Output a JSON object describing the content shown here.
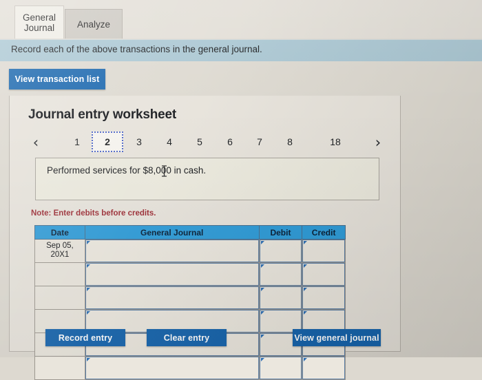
{
  "tabs": [
    {
      "label": "General\nJournal",
      "label_line1": "General",
      "label_line2": "Journal",
      "active": true
    },
    {
      "label": "Analyze",
      "active": false
    }
  ],
  "banner": {
    "text": "Record each of the above transactions in the general journal."
  },
  "buttons": {
    "view_transaction_list": "View transaction list",
    "record_entry": "Record entry",
    "clear_entry": "Clear entry",
    "view_general_journal": "View general journal"
  },
  "worksheet": {
    "title": "Journal entry worksheet",
    "pager": {
      "prev_icon": "chevron-left",
      "prev_glyph": "‹",
      "next_icon": "chevron-right",
      "next_glyph": "›",
      "pages": [
        "1",
        "2",
        "3",
        "4",
        "5",
        "6",
        "7",
        "8",
        "18"
      ],
      "selected": "2"
    },
    "description": "Performed services for $8,000 in cash.",
    "note": "Note: Enter debits before credits."
  },
  "table": {
    "headers": [
      "Date",
      "General Journal",
      "Debit",
      "Credit"
    ],
    "rows": [
      {
        "date_line1": "Sep 05,",
        "date_line2": "20X1",
        "general_journal": "",
        "debit": "",
        "credit": ""
      },
      {
        "date_line1": "",
        "date_line2": "",
        "general_journal": "",
        "debit": "",
        "credit": ""
      },
      {
        "date_line1": "",
        "date_line2": "",
        "general_journal": "",
        "debit": "",
        "credit": ""
      },
      {
        "date_line1": "",
        "date_line2": "",
        "general_journal": "",
        "debit": "",
        "credit": ""
      },
      {
        "date_line1": "",
        "date_line2": "",
        "general_journal": "",
        "debit": "",
        "credit": ""
      },
      {
        "date_line1": "",
        "date_line2": "",
        "general_journal": "",
        "debit": "",
        "credit": ""
      }
    ]
  },
  "colors": {
    "primary_button": "#1765ad",
    "banner": "#a9c6d2",
    "table_header": "#2f9cd8",
    "note_text": "#9c2c34",
    "selection_outline": "#4a63c8",
    "page_background": "#ddd9d0"
  }
}
